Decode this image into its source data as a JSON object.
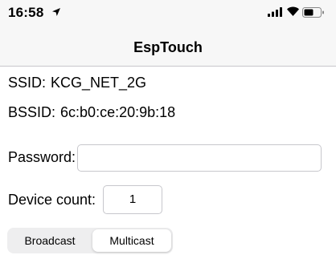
{
  "status_bar": {
    "time": "16:58",
    "icons": [
      "location-arrow-icon",
      "cellular-signal-icon",
      "wifi-icon",
      "battery-icon"
    ]
  },
  "nav": {
    "title": "EspTouch"
  },
  "network": {
    "ssid_label": "SSID:",
    "ssid_value": "KCG_NET_2G",
    "bssid_label": "BSSID:",
    "bssid_value": "6c:b0:ce:20:9b:18"
  },
  "form": {
    "password_label": "Password:",
    "password_value": "",
    "device_count_label": "Device count:",
    "device_count_value": "1"
  },
  "mode": {
    "options": [
      "Broadcast",
      "Multicast"
    ],
    "selected": "Multicast"
  },
  "colors": {
    "bar_background": "#f7f7f7",
    "separator": "#c8c7cc",
    "field_border": "#c7c7cc",
    "segment_track": "#eeeeef"
  }
}
